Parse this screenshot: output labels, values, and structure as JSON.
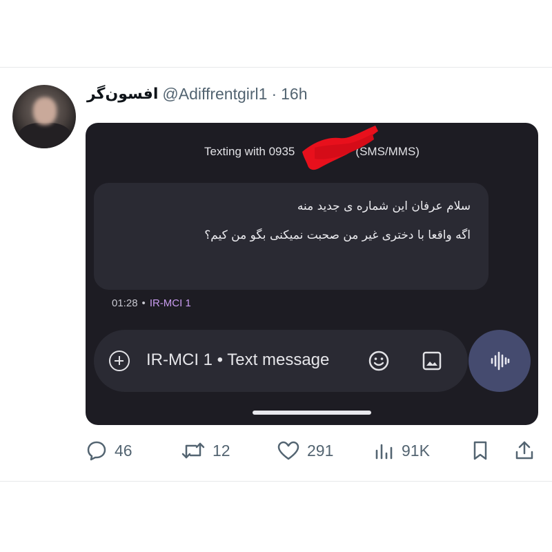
{
  "tweet": {
    "display_name": "افسون‌گر",
    "handle": "@Adiffrentgirl1",
    "separator": "·",
    "time": "16h"
  },
  "embedded_screenshot": {
    "header_prefix": "Texting with 0935",
    "header_suffix": "(SMS/MMS)",
    "message_lines": [
      "سلام عرفان این شماره ی جدید منه",
      "اگه واقعا با دختری غیر من صحبت نمیکنی بگو من کیم؟"
    ],
    "message_time": "01:28",
    "meta_separator": "•",
    "sim_label": "IR-MCI 1",
    "composer_placeholder": "IR-MCI 1 • Text message",
    "icons": [
      "add-circle-icon",
      "emoji-icon",
      "image-icon",
      "voice-waveform-icon"
    ],
    "redaction_color": "#e8101c"
  },
  "actions": {
    "replies": "46",
    "reposts": "12",
    "likes": "291",
    "views": "91K"
  }
}
